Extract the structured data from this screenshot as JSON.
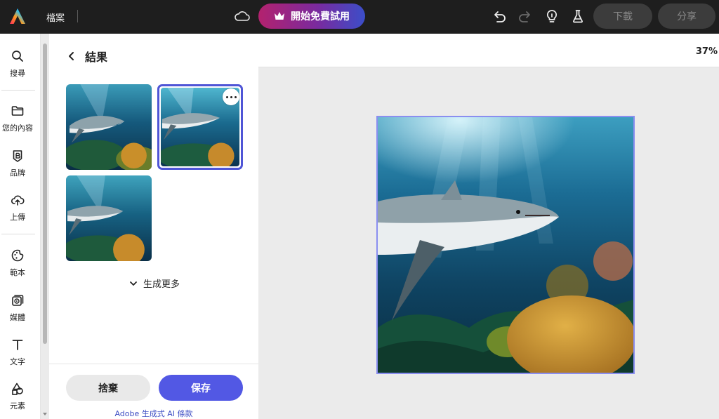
{
  "header": {
    "file_menu": "檔案",
    "trial_button": "開始免費試用",
    "download_button": "下載",
    "share_button": "分享"
  },
  "rail": {
    "items": [
      {
        "label": "搜尋",
        "icon": "search-icon"
      },
      {
        "label": "您的內容",
        "icon": "folder-icon"
      },
      {
        "label": "品牌",
        "icon": "brand-icon"
      },
      {
        "label": "上傳",
        "icon": "upload-icon"
      },
      {
        "label": "範本",
        "icon": "template-icon"
      },
      {
        "label": "媒體",
        "icon": "media-icon"
      },
      {
        "label": "文字",
        "icon": "text-icon"
      },
      {
        "label": "元素",
        "icon": "elements-icon"
      }
    ]
  },
  "panel": {
    "title": "結果",
    "results": [
      "shark-result-1",
      "shark-result-2",
      "shark-result-3"
    ],
    "selected_index": 1,
    "generate_more": "生成更多",
    "discard_button": "捨棄",
    "save_button": "保存",
    "terms_link": "Adobe 生成式 AI 條款"
  },
  "canvas": {
    "zoom": "37%"
  },
  "colors": {
    "accent": "#5258e4",
    "topbar": "#1e1e1e",
    "selection": "#4f55d6"
  }
}
